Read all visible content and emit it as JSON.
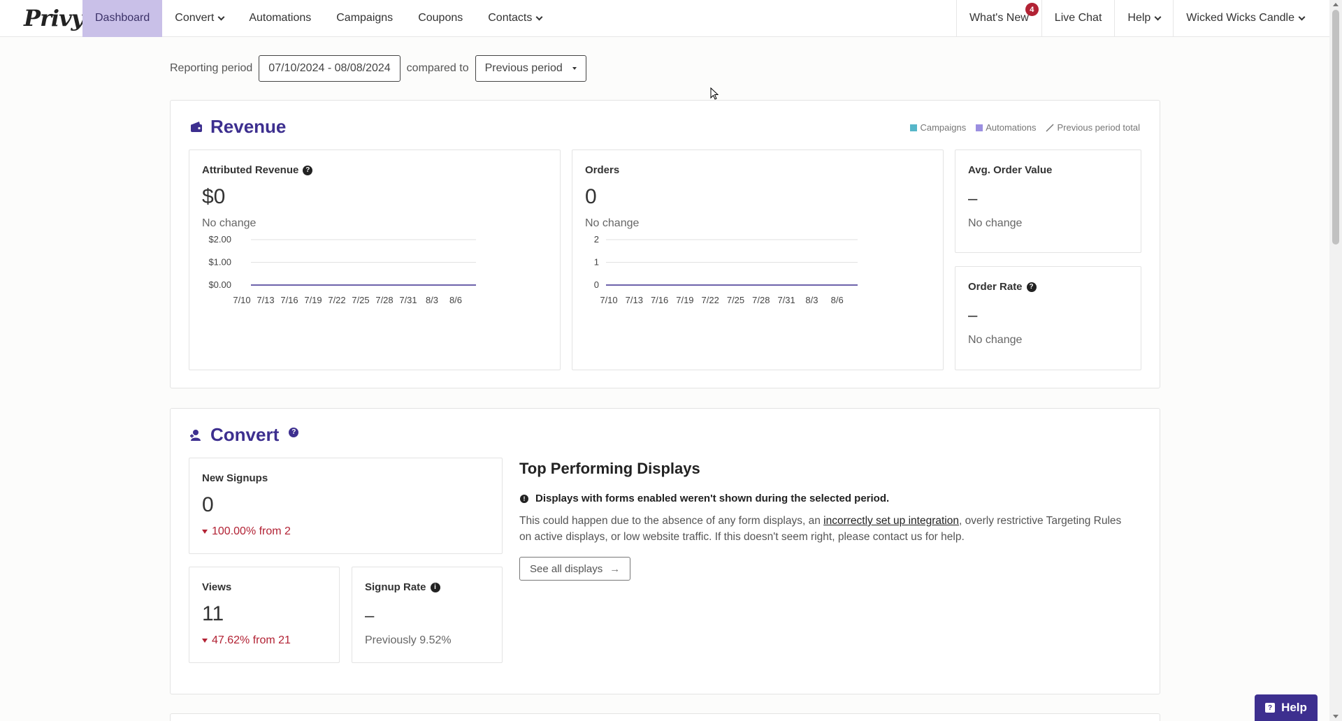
{
  "nav": {
    "logo": "Privy",
    "items": [
      {
        "label": "Dashboard",
        "active": true
      },
      {
        "label": "Convert",
        "dropdown": true
      },
      {
        "label": "Automations"
      },
      {
        "label": "Campaigns"
      },
      {
        "label": "Coupons"
      },
      {
        "label": "Contacts",
        "dropdown": true
      }
    ],
    "right": {
      "whats_new": "What's New",
      "whats_new_badge": "4",
      "live_chat": "Live Chat",
      "help": "Help",
      "account": "Wicked Wicks Candle"
    }
  },
  "reporting": {
    "label": "Reporting period",
    "range": "07/10/2024 - 08/08/2024",
    "compared_label": "compared to",
    "compare_option": "Previous period"
  },
  "revenue": {
    "title": "Revenue",
    "legend": [
      "Campaigns",
      "Automations",
      "Previous period total"
    ],
    "colors": {
      "campaigns": "#56b6c9",
      "automations": "#9b8fe0",
      "accent": "#3d2f8f"
    },
    "attributed": {
      "label": "Attributed Revenue",
      "value": "$0",
      "change": "No change"
    },
    "orders": {
      "label": "Orders",
      "value": "0",
      "change": "No change"
    },
    "aov": {
      "label": "Avg. Order Value",
      "value": "–",
      "change": "No change"
    },
    "order_rate": {
      "label": "Order Rate",
      "value": "–",
      "change": "No change"
    }
  },
  "chart_data": [
    {
      "type": "line",
      "x": [
        "7/10",
        "7/13",
        "7/16",
        "7/19",
        "7/22",
        "7/25",
        "7/28",
        "7/31",
        "8/3",
        "8/6"
      ],
      "yticks": [
        "$0.00",
        "$1.00",
        "$2.00"
      ],
      "ylim": [
        0,
        2
      ],
      "series": [
        {
          "values": [
            0,
            0,
            0,
            0,
            0,
            0,
            0,
            0,
            0,
            0
          ]
        }
      ]
    },
    {
      "type": "line",
      "x": [
        "7/10",
        "7/13",
        "7/16",
        "7/19",
        "7/22",
        "7/25",
        "7/28",
        "7/31",
        "8/3",
        "8/6"
      ],
      "yticks": [
        "0",
        "1",
        "2"
      ],
      "ylim": [
        0,
        2
      ],
      "series": [
        {
          "values": [
            0,
            0,
            0,
            0,
            0,
            0,
            0,
            0,
            0,
            0
          ]
        }
      ]
    }
  ],
  "convert": {
    "title": "Convert",
    "new_signups": {
      "label": "New Signups",
      "value": "0",
      "change": "100.00% from 2"
    },
    "views": {
      "label": "Views",
      "value": "11",
      "change": "47.62% from 21"
    },
    "signup_rate": {
      "label": "Signup Rate",
      "value": "–",
      "change": "Previously 9.52%"
    },
    "top": {
      "title": "Top Performing Displays",
      "info": "Displays with forms enabled weren't shown during the selected period.",
      "para_before": "This could happen due to the absence of any form displays, an ",
      "para_link": "incorrectly set up integration",
      "para_after": ", overly restrictive Targeting Rules on active displays, or low website traffic. If this doesn't seem right, please contact us for help.",
      "button": "See all displays"
    }
  },
  "help_button": "Help"
}
